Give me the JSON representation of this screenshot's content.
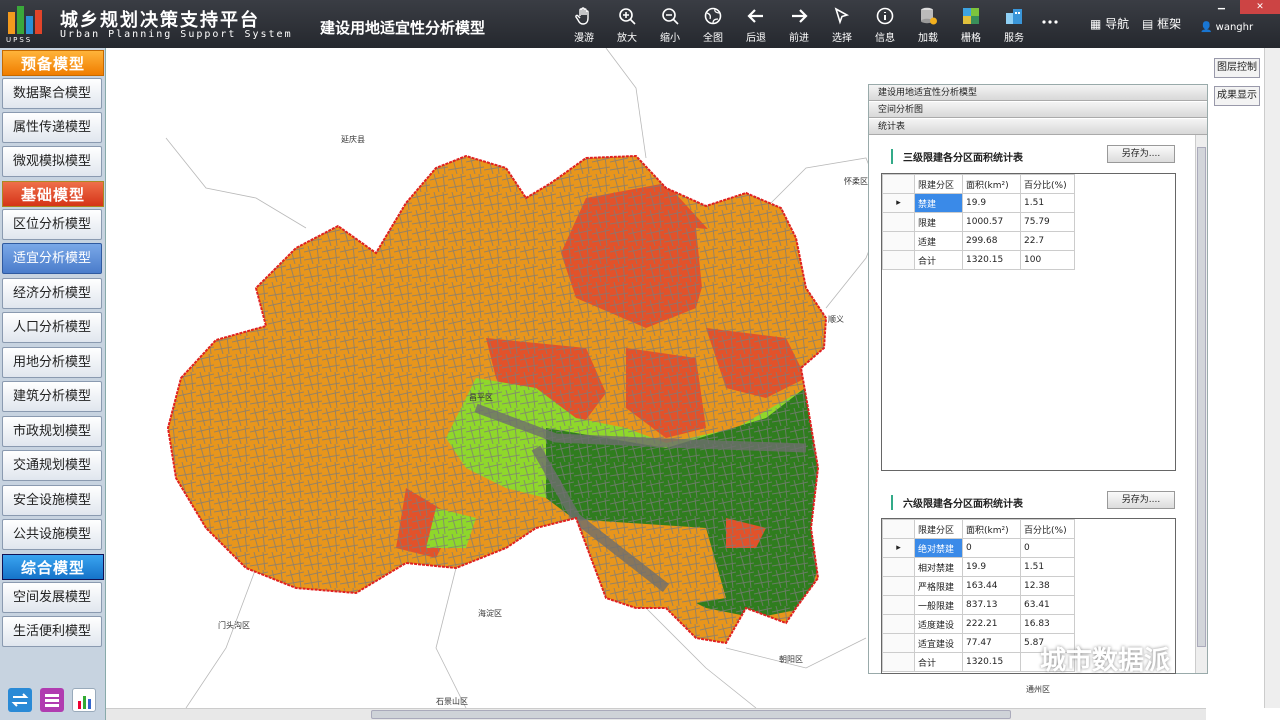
{
  "app": {
    "title_cn": "城乡规划决策支持平台",
    "title_en": "Urban Planning Support System",
    "logo_text": "UPSS",
    "model_title": "建设用地适宜性分析模型"
  },
  "toolbar": [
    {
      "label": "漫游",
      "icon": "hand-icon"
    },
    {
      "label": "放大",
      "icon": "zoom-in-icon"
    },
    {
      "label": "缩小",
      "icon": "zoom-out-icon"
    },
    {
      "label": "全图",
      "icon": "globe-icon"
    },
    {
      "label": "后退",
      "icon": "arrow-left-icon"
    },
    {
      "label": "前进",
      "icon": "arrow-right-icon"
    },
    {
      "label": "选择",
      "icon": "cursor-icon"
    },
    {
      "label": "信息",
      "icon": "info-icon"
    },
    {
      "label": "加载",
      "icon": "database-icon"
    },
    {
      "label": "栅格",
      "icon": "raster-icon"
    },
    {
      "label": "服务",
      "icon": "server-icon"
    },
    {
      "label": "",
      "icon": "more-icon"
    }
  ],
  "topright": {
    "nav": "导航",
    "frame": "框架",
    "user": "wanghr"
  },
  "sidebar": {
    "cat1": "预备模型",
    "cat1_items": [
      "数据聚合模型",
      "属性传递模型",
      "微观模拟模型"
    ],
    "cat2": "基础模型",
    "cat2_items": [
      "区位分析模型",
      "适宜分析模型",
      "经济分析模型",
      "人口分析模型",
      "用地分析模型",
      "建筑分析模型",
      "市政规划模型",
      "交通规划模型",
      "安全设施模型",
      "公共设施模型"
    ],
    "cat3": "综合模型",
    "cat3_items": [
      "空间发展模型",
      "生活便利模型"
    ],
    "active": "适宜分析模型"
  },
  "right_buttons": {
    "layer_control": "图层控制",
    "result_display": "成果显示"
  },
  "panel": {
    "header1": "建设用地适宜性分析模型",
    "header2": "空间分析图",
    "header3": "统计表",
    "table1": {
      "title": "三级限建各分区面积统计表",
      "save_label": "另存为....",
      "columns": [
        "限建分区",
        "面积(km²)",
        "百分比(%)"
      ],
      "rows": [
        [
          "禁建",
          "19.9",
          "1.51"
        ],
        [
          "限建",
          "1000.57",
          "75.79"
        ],
        [
          "适建",
          "299.68",
          "22.7"
        ],
        [
          "合计",
          "1320.15",
          "100"
        ]
      ]
    },
    "table2": {
      "title": "六级限建各分区面积统计表",
      "save_label": "另存为....",
      "columns": [
        "限建分区",
        "面积(km²)",
        "百分比(%)"
      ],
      "rows": [
        [
          "绝对禁建",
          "0",
          "0"
        ],
        [
          "相对禁建",
          "19.9",
          "1.51"
        ],
        [
          "严格限建",
          "163.44",
          "12.38"
        ],
        [
          "一般限建",
          "837.13",
          "63.41"
        ],
        [
          "适度建设",
          "222.21",
          "16.83"
        ],
        [
          "适宜建设",
          "77.47",
          "5.87"
        ],
        [
          "合计",
          "1320.15",
          ""
        ]
      ]
    }
  },
  "map_labels": {
    "north": "延庆县",
    "east": "怀柔区",
    "center": "昌平区",
    "southwest": "门头沟区",
    "south": "海淀区",
    "southeast": "朝阳区",
    "bottom": "石景山区",
    "bottomright": "通州区",
    "eastedge": "顺义"
  },
  "watermark": "城市数据派",
  "colors": {
    "topbar": "#2f3238",
    "orange": "#e8961c",
    "redorange": "#e2522a",
    "light_green": "#8fd82b",
    "dark_green": "#2f7d1e",
    "boundary": "#e02020",
    "roads": "#777777",
    "active_button": "#4a7ccb"
  }
}
